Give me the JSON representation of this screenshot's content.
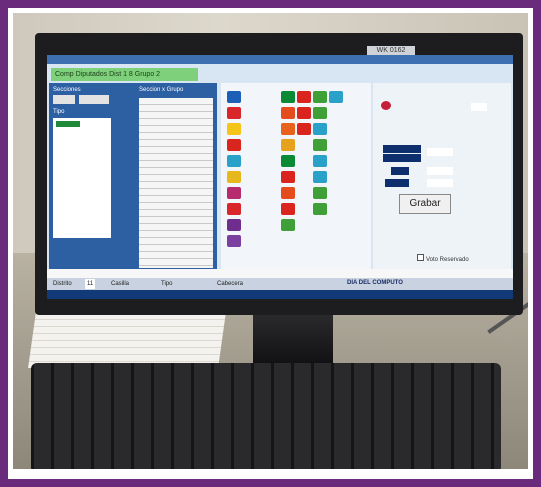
{
  "monitor_label": "WK 0162",
  "app": {
    "header_title": "Comp Diputados Dist 1 8 Grupo 2",
    "secciones_label": "Secciones",
    "seccion_grupo_label": "Seccion x Grupo",
    "tipo_label": "Tipo",
    "grabar_button": "Grabar",
    "voto_label": "Voto Reservado",
    "status_banner": "DIA DEL COMPUTO",
    "status_items": [
      "Distrito",
      "11",
      "Casilla",
      "Tipo",
      "Cabecera"
    ]
  },
  "colors": {
    "window_blue": "#3e6fb1",
    "header_green": "#7ed07a",
    "field_navy": "#0d2f6e",
    "screen_bg": "#d7e6f2"
  }
}
